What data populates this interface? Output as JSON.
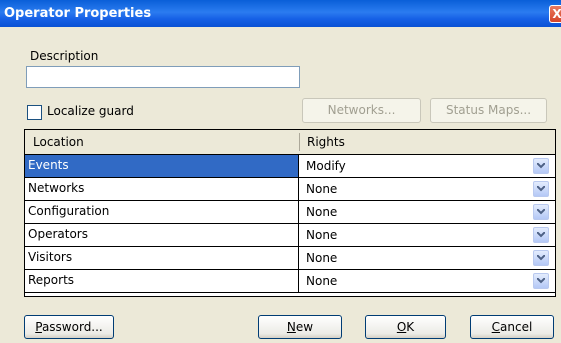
{
  "window": {
    "title": "Operator Properties",
    "close_glyph": "X"
  },
  "description": {
    "label": "Description",
    "value": ""
  },
  "localize_guard": {
    "label": "Localize guard",
    "checked": false
  },
  "buttons": {
    "networks": "Networks...",
    "status_maps": "Status Maps...",
    "password_underlined": "P",
    "password_rest": "assword...",
    "new_underlined": "N",
    "new_rest": "ew",
    "ok_underlined": "O",
    "ok_rest": "K",
    "cancel_underlined": "C",
    "cancel_rest": "ancel"
  },
  "grid": {
    "columns": [
      "Location",
      "Rights"
    ],
    "rows": [
      {
        "location": "Events",
        "rights": "Modify",
        "selected": true
      },
      {
        "location": "Networks",
        "rights": "None"
      },
      {
        "location": "Configuration",
        "rights": "None"
      },
      {
        "location": "Operators",
        "rights": "None"
      },
      {
        "location": "Visitors",
        "rights": "None"
      },
      {
        "location": "Reports",
        "rights": "None"
      }
    ]
  },
  "icons": {
    "dropdown": "chevron-down-icon",
    "close": "close-icon",
    "checkbox": "checkbox"
  },
  "colors": {
    "titlebar": "#0a5fd8",
    "selection": "#316ac5",
    "face": "#ece9d8"
  }
}
